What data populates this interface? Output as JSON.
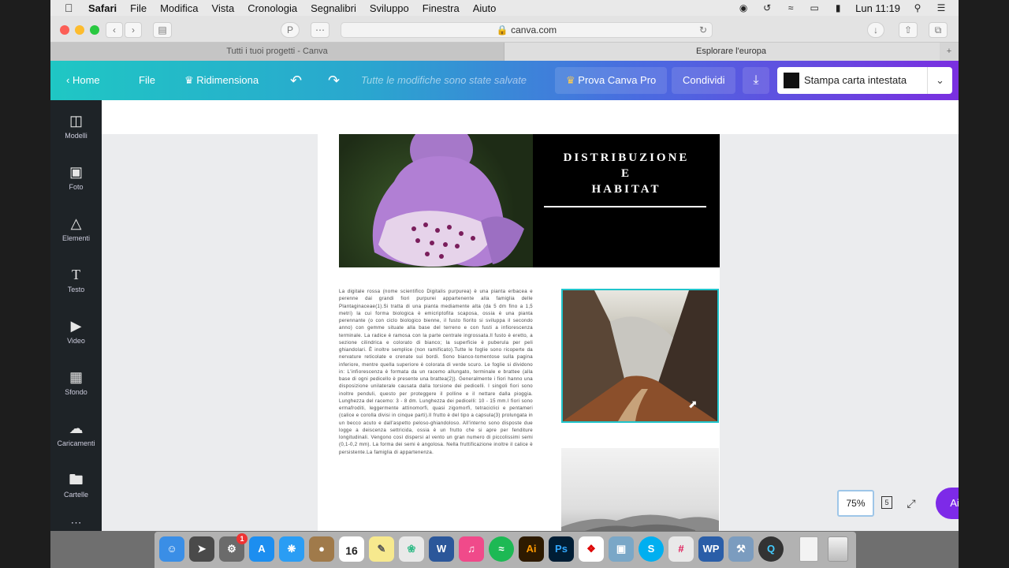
{
  "menubar": {
    "app": "Safari",
    "items": [
      "File",
      "Modifica",
      "Vista",
      "Cronologia",
      "Segnalibri",
      "Sviluppo",
      "Finestra",
      "Aiuto"
    ],
    "clock": "Lun 11:19"
  },
  "browser": {
    "url": "canva.com",
    "tabs": [
      "Tutti i tuoi progetti - Canva",
      "Esplorare l'europa"
    ],
    "new_tab": "+"
  },
  "canva_header": {
    "home": "Home",
    "file": "File",
    "resize": "Ridimensiona",
    "status": "Tutte le modifiche sono state salvate",
    "pro": "Prova Canva Pro",
    "share": "Condividi",
    "print_label": "Stampa carta intestata"
  },
  "sidebar": {
    "items": [
      {
        "label": "Modelli",
        "icon": "templates-icon"
      },
      {
        "label": "Foto",
        "icon": "photo-icon"
      },
      {
        "label": "Elementi",
        "icon": "elements-icon"
      },
      {
        "label": "Testo",
        "icon": "text-icon"
      },
      {
        "label": "Video",
        "icon": "video-icon"
      },
      {
        "label": "Sfondo",
        "icon": "background-icon"
      },
      {
        "label": "Caricamenti",
        "icon": "upload-cloud-icon"
      },
      {
        "label": "Cartelle",
        "icon": "folder-icon"
      }
    ]
  },
  "document": {
    "title_lines": [
      "DISTRIBUZIONE",
      "E",
      "HABITAT"
    ],
    "body": "La digitale rossa (nome scientifico Digitalis purpurea) è una pianta erbacea e perenne dai grandi fiori purpurei appartenente alla famiglia delle Plantaginaceae(1).Si tratta di una pianta mediamente alta (da 5 dm fino a 1,5 metri) la cui forma biologica è emicriptofita scaposa, ossia è una pianta perennante (o con ciclo biologico bienne, il fusto fiorito si sviluppa il secondo anno) con gemme situate alla base del terreno e con fusti a infiorescenza terminale. La radice è ramosa con la parte centrale ingrossata.Il fusto è eretto, a sezione cilindrica e colorato di bianco; la superficie è puberula per peli ghiandolari. È inoltre semplice (non ramificato).Tutte le foglie sono ricoperte da nervature reticolate e crenate sui bordi. Sono bianco-tomentose sulla pagina inferiore, mentre quella superiore è colorata di verde scuro. Le foglie si dividono in: L'infiorescenza è formata da un racemo allungato, terminale e brattee (alla base di ogni pedicello è presente una brattea(2)). Generalmente i fiori hanno una disposizione unilaterale causata dalla torsione dei pedicelli. I singoli fiori sono inoltre penduli, questo per proteggere il polline e il nettare dalla pioggia. Lunghezza del racemo: 3 - 8 dm. Lunghezza dei pedicelli: 10 - 15 mm.I fiori sono ermafroditi, leggermente attinomorfi, quasi zigomorfi, tetraciclici e pentameri (calice e corolla divisi in cinque parti).Il frutto è del tipo a capsula(3) prolungata in un becco acuto e dall'aspetto peloso-ghiandoloso. All'interno sono disposte due logge a deiscenza settricida, ossia è un frutto che si apre per fenditure longitudinali. Vengono così dispersi al vento un gran numero di piccolissimi semi (0,1-0,2 mm). La forma dei semi è angolosa. Nella fruttificazione inoltre il calice è persistente.La famiglia di appartenenza."
  },
  "controls": {
    "zoom": "75%",
    "page_count": "5",
    "help": "Aiuto ?"
  },
  "dock": {
    "calendar_day": "16",
    "badge": "1"
  },
  "colors": {
    "accent_teal": "#20c4cb",
    "brand_purple": "#7d2ae8"
  }
}
